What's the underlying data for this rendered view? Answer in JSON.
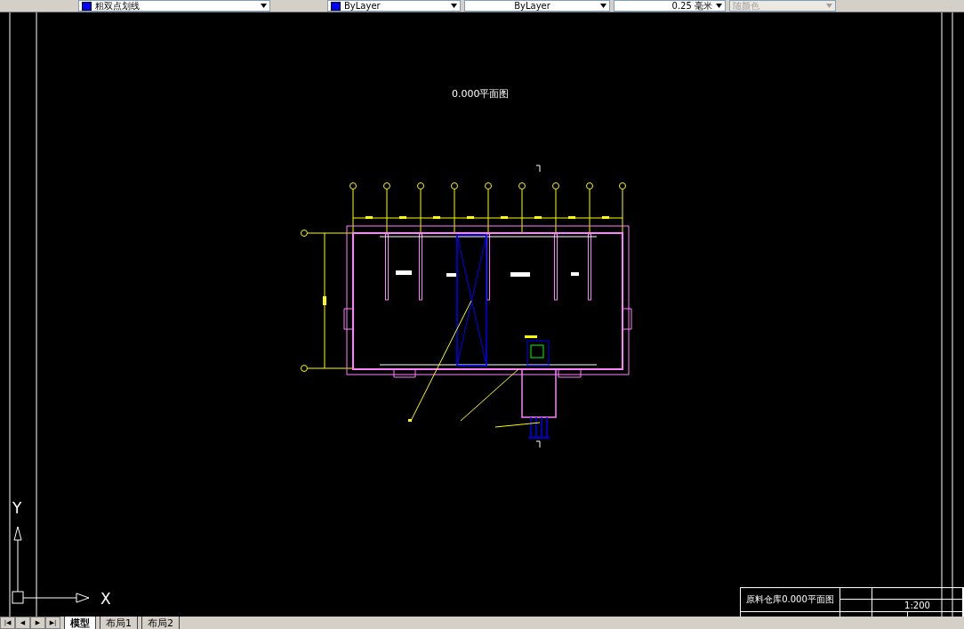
{
  "toolbar": {
    "layer": "粗双点划线",
    "color_setting": "ByLayer",
    "linetype": "ByLayer",
    "lineweight": "0.25 毫米",
    "plot_style": {
      "value": "随颜色",
      "disabled": true
    }
  },
  "drawing": {
    "title": "0.000平面图",
    "title_block": {
      "name": "原料仓库0.000平面图",
      "scale": "1:200"
    }
  },
  "ucs": {
    "x_label": "X",
    "y_label": "Y"
  },
  "layout_tabs": {
    "nav": [
      "|◀",
      "◀",
      "▶",
      "▶|"
    ],
    "tabs": [
      {
        "label": "模型",
        "selected": true
      },
      {
        "label": "布局1",
        "selected": false
      },
      {
        "label": "布局2",
        "selected": false
      }
    ]
  }
}
